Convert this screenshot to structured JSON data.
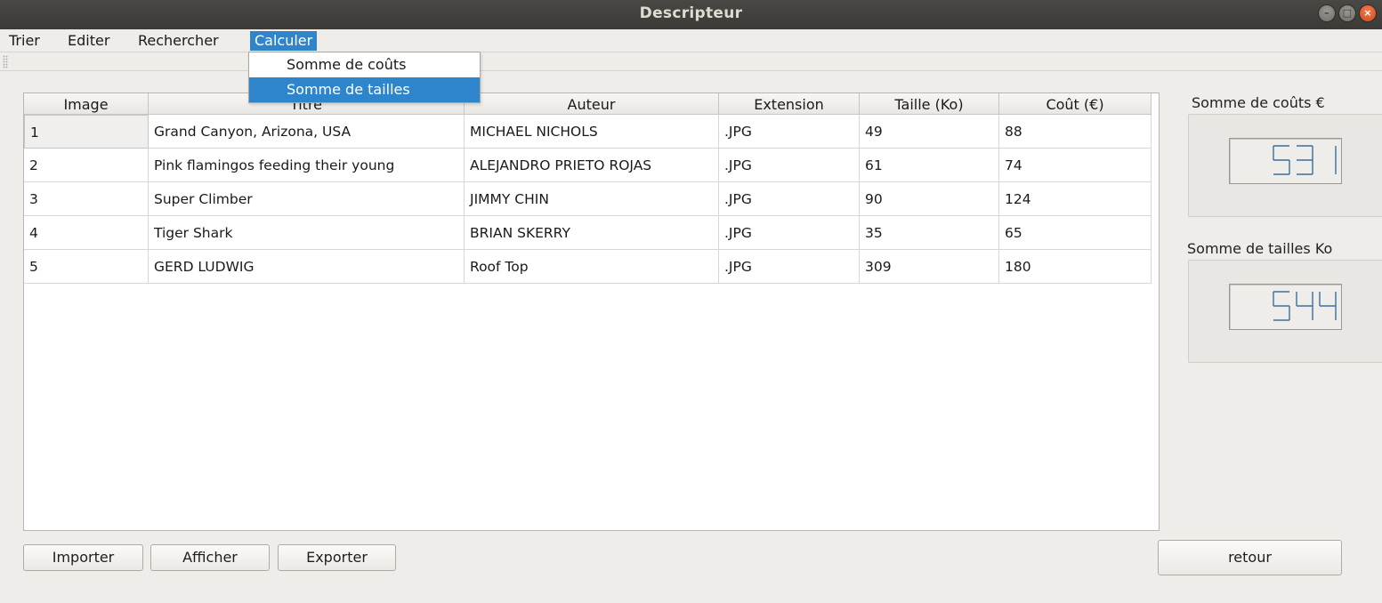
{
  "window": {
    "title": "Descripteur"
  },
  "menubar": {
    "items": [
      "Trier",
      "Editer",
      "Rechercher",
      "Calculer"
    ],
    "active": "Calculer"
  },
  "calculer_menu": {
    "items": [
      "Somme de coûts",
      "Somme de tailles"
    ],
    "highlighted": "Somme de tailles"
  },
  "table": {
    "columns": [
      "Image",
      "Titre",
      "Auteur",
      "Extension",
      "Taille (Ko)",
      "Coût (€)"
    ],
    "rows": [
      [
        "1",
        "Grand Canyon, Arizona, USA",
        "MICHAEL NICHOLS",
        ".JPG",
        "49",
        "88"
      ],
      [
        "2",
        "Pink flamingos feeding their young",
        "ALEJANDRO PRIETO ROJAS",
        ".JPG",
        "61",
        "74"
      ],
      [
        "3",
        "Super Climber",
        "JIMMY CHIN",
        ".JPG",
        "90",
        "124"
      ],
      [
        "4",
        "Tiger Shark",
        "BRIAN SKERRY",
        ".JPG",
        "35",
        "65"
      ],
      [
        "5",
        "GERD LUDWIG",
        "Roof Top",
        ".JPG",
        "309",
        "180"
      ]
    ]
  },
  "side": {
    "cost_label": "Somme de coûts  €",
    "cost_value": "531",
    "size_label": "Somme de tailles Ko",
    "size_value": "544"
  },
  "buttons": {
    "importer": "Importer",
    "afficher": "Afficher",
    "exporter": "Exporter",
    "retour": "retour"
  },
  "icons": {
    "minimize": "minimize-icon",
    "maximize": "maximize-icon",
    "close": "close-icon"
  },
  "colors": {
    "accent": "#2f85cc",
    "titlebar": "#3b3a37",
    "close": "#e05a2a"
  }
}
